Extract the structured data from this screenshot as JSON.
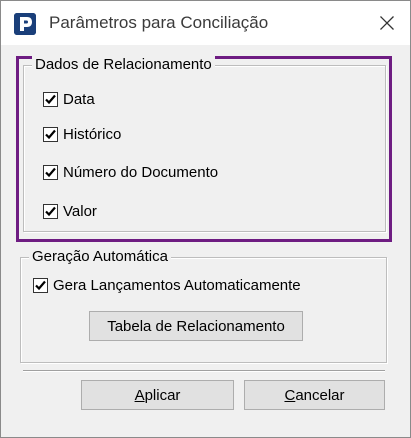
{
  "window": {
    "title": "Parâmetros para Conciliação",
    "accent_color": "#6e1c82"
  },
  "group_relacionamento": {
    "legend": "Dados de Relacionamento",
    "checks": [
      {
        "label": "Data",
        "checked": true
      },
      {
        "label": "Histórico",
        "checked": true
      },
      {
        "label": "Número do Documento",
        "checked": true
      },
      {
        "label": "Valor",
        "checked": true
      }
    ]
  },
  "group_geracao": {
    "legend": "Geração Automática",
    "check_label": "Gera Lançamentos Automaticamente",
    "checked": true,
    "table_button": "Tabela de Relacionamento"
  },
  "buttons": {
    "apply_underlined": "A",
    "apply_rest": "plicar",
    "cancel_underlined": "C",
    "cancel_rest": "ancelar"
  },
  "icons": {
    "app": "app-logo-icon",
    "close": "close-icon",
    "check": "checkmark-icon"
  }
}
